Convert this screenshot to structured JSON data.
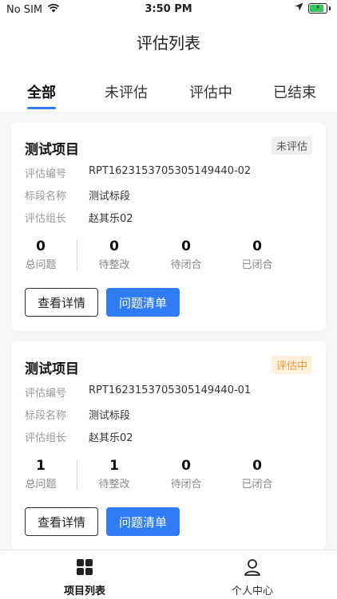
{
  "status_bar": {
    "carrier": "No SIM",
    "time": "3:50 PM"
  },
  "header": {
    "title": "评估列表"
  },
  "tabs": [
    {
      "label": "全部",
      "active": true
    },
    {
      "label": "未评估",
      "active": false
    },
    {
      "label": "评估中",
      "active": false
    },
    {
      "label": "已结束",
      "active": false
    }
  ],
  "cards": [
    {
      "title": "测试项目",
      "status": "未评估",
      "fields": [
        {
          "label": "评估编号",
          "value": "RPT1623153705305149440-02"
        },
        {
          "label": "标段名称",
          "value": "测试标段"
        },
        {
          "label": "评估组长",
          "value": "赵其乐02"
        }
      ],
      "stats": [
        {
          "value": "0",
          "label": "总问题"
        },
        {
          "value": "0",
          "label": "待整改"
        },
        {
          "value": "0",
          "label": "待闭合"
        },
        {
          "value": "0",
          "label": "已闭合"
        }
      ],
      "detail_button": "查看详情",
      "issues_button": "问题清单"
    },
    {
      "title": "测试项目",
      "status": "评估中",
      "fields": [
        {
          "label": "评估编号",
          "value": "RPT1623153705305149440-01"
        },
        {
          "label": "标段名称",
          "value": "测试标段"
        },
        {
          "label": "评估组长",
          "value": "赵其乐02"
        }
      ],
      "stats": [
        {
          "value": "1",
          "label": "总问题"
        },
        {
          "value": "1",
          "label": "待整改"
        },
        {
          "value": "0",
          "label": "待闭合"
        },
        {
          "value": "0",
          "label": "已闭合"
        }
      ],
      "detail_button": "查看详情",
      "issues_button": "问题清单"
    }
  ],
  "tabbar": [
    {
      "label": "项目列表",
      "icon": "grid-icon",
      "active": true
    },
    {
      "label": "个人中心",
      "icon": "person-icon",
      "active": false
    }
  ],
  "colors": {
    "primary": "#2f7cf6",
    "badge_orange": "#f0962a",
    "badge_orange_bg": "#fdf0dd"
  }
}
